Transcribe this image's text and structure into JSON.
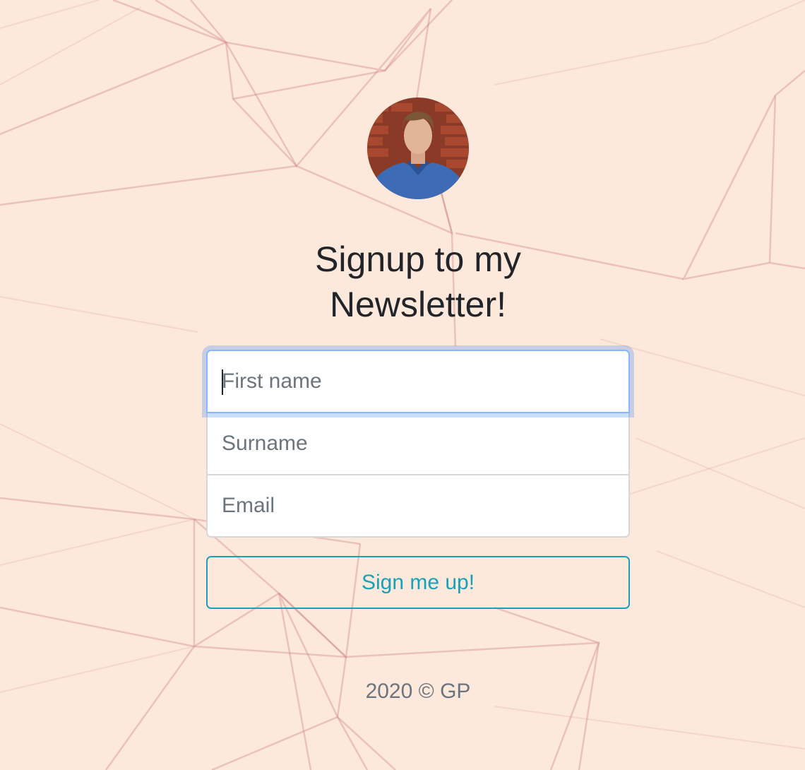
{
  "title_line1": "Signup to my",
  "title_line2": "Newsletter!",
  "form": {
    "first_name_placeholder": "First name",
    "surname_placeholder": "Surname",
    "email_placeholder": "Email",
    "submit_label": "Sign me up!"
  },
  "footer": "2020 © GP",
  "colors": {
    "background": "#fde8dc",
    "accent": "#17a2b8",
    "focus": "#86b7fe",
    "pattern_lines": "#c97a7a"
  }
}
